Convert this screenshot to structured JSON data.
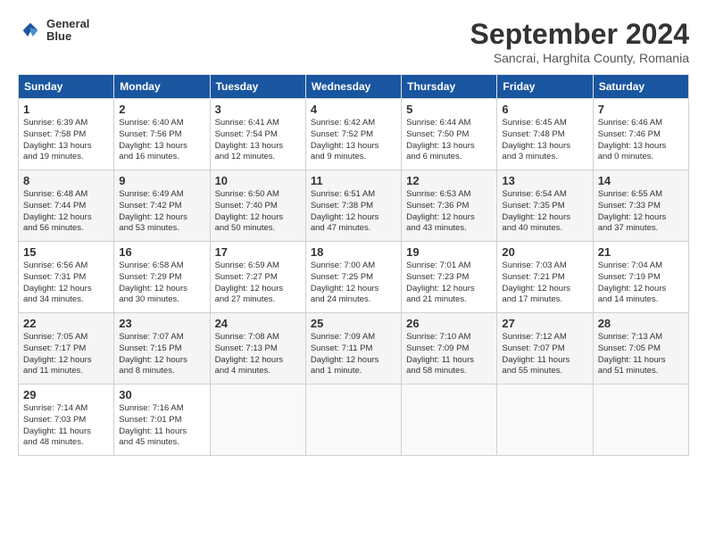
{
  "header": {
    "logo_line1": "General",
    "logo_line2": "Blue",
    "month": "September 2024",
    "location": "Sancrai, Harghita County, Romania"
  },
  "weekdays": [
    "Sunday",
    "Monday",
    "Tuesday",
    "Wednesday",
    "Thursday",
    "Friday",
    "Saturday"
  ],
  "weeks": [
    [
      {
        "day": "1",
        "info": "Sunrise: 6:39 AM\nSunset: 7:58 PM\nDaylight: 13 hours\nand 19 minutes."
      },
      {
        "day": "2",
        "info": "Sunrise: 6:40 AM\nSunset: 7:56 PM\nDaylight: 13 hours\nand 16 minutes."
      },
      {
        "day": "3",
        "info": "Sunrise: 6:41 AM\nSunset: 7:54 PM\nDaylight: 13 hours\nand 12 minutes."
      },
      {
        "day": "4",
        "info": "Sunrise: 6:42 AM\nSunset: 7:52 PM\nDaylight: 13 hours\nand 9 minutes."
      },
      {
        "day": "5",
        "info": "Sunrise: 6:44 AM\nSunset: 7:50 PM\nDaylight: 13 hours\nand 6 minutes."
      },
      {
        "day": "6",
        "info": "Sunrise: 6:45 AM\nSunset: 7:48 PM\nDaylight: 13 hours\nand 3 minutes."
      },
      {
        "day": "7",
        "info": "Sunrise: 6:46 AM\nSunset: 7:46 PM\nDaylight: 13 hours\nand 0 minutes."
      }
    ],
    [
      {
        "day": "8",
        "info": "Sunrise: 6:48 AM\nSunset: 7:44 PM\nDaylight: 12 hours\nand 56 minutes."
      },
      {
        "day": "9",
        "info": "Sunrise: 6:49 AM\nSunset: 7:42 PM\nDaylight: 12 hours\nand 53 minutes."
      },
      {
        "day": "10",
        "info": "Sunrise: 6:50 AM\nSunset: 7:40 PM\nDaylight: 12 hours\nand 50 minutes."
      },
      {
        "day": "11",
        "info": "Sunrise: 6:51 AM\nSunset: 7:38 PM\nDaylight: 12 hours\nand 47 minutes."
      },
      {
        "day": "12",
        "info": "Sunrise: 6:53 AM\nSunset: 7:36 PM\nDaylight: 12 hours\nand 43 minutes."
      },
      {
        "day": "13",
        "info": "Sunrise: 6:54 AM\nSunset: 7:35 PM\nDaylight: 12 hours\nand 40 minutes."
      },
      {
        "day": "14",
        "info": "Sunrise: 6:55 AM\nSunset: 7:33 PM\nDaylight: 12 hours\nand 37 minutes."
      }
    ],
    [
      {
        "day": "15",
        "info": "Sunrise: 6:56 AM\nSunset: 7:31 PM\nDaylight: 12 hours\nand 34 minutes."
      },
      {
        "day": "16",
        "info": "Sunrise: 6:58 AM\nSunset: 7:29 PM\nDaylight: 12 hours\nand 30 minutes."
      },
      {
        "day": "17",
        "info": "Sunrise: 6:59 AM\nSunset: 7:27 PM\nDaylight: 12 hours\nand 27 minutes."
      },
      {
        "day": "18",
        "info": "Sunrise: 7:00 AM\nSunset: 7:25 PM\nDaylight: 12 hours\nand 24 minutes."
      },
      {
        "day": "19",
        "info": "Sunrise: 7:01 AM\nSunset: 7:23 PM\nDaylight: 12 hours\nand 21 minutes."
      },
      {
        "day": "20",
        "info": "Sunrise: 7:03 AM\nSunset: 7:21 PM\nDaylight: 12 hours\nand 17 minutes."
      },
      {
        "day": "21",
        "info": "Sunrise: 7:04 AM\nSunset: 7:19 PM\nDaylight: 12 hours\nand 14 minutes."
      }
    ],
    [
      {
        "day": "22",
        "info": "Sunrise: 7:05 AM\nSunset: 7:17 PM\nDaylight: 12 hours\nand 11 minutes."
      },
      {
        "day": "23",
        "info": "Sunrise: 7:07 AM\nSunset: 7:15 PM\nDaylight: 12 hours\nand 8 minutes."
      },
      {
        "day": "24",
        "info": "Sunrise: 7:08 AM\nSunset: 7:13 PM\nDaylight: 12 hours\nand 4 minutes."
      },
      {
        "day": "25",
        "info": "Sunrise: 7:09 AM\nSunset: 7:11 PM\nDaylight: 12 hours\nand 1 minute."
      },
      {
        "day": "26",
        "info": "Sunrise: 7:10 AM\nSunset: 7:09 PM\nDaylight: 11 hours\nand 58 minutes."
      },
      {
        "day": "27",
        "info": "Sunrise: 7:12 AM\nSunset: 7:07 PM\nDaylight: 11 hours\nand 55 minutes."
      },
      {
        "day": "28",
        "info": "Sunrise: 7:13 AM\nSunset: 7:05 PM\nDaylight: 11 hours\nand 51 minutes."
      }
    ],
    [
      {
        "day": "29",
        "info": "Sunrise: 7:14 AM\nSunset: 7:03 PM\nDaylight: 11 hours\nand 48 minutes."
      },
      {
        "day": "30",
        "info": "Sunrise: 7:16 AM\nSunset: 7:01 PM\nDaylight: 11 hours\nand 45 minutes."
      },
      {
        "day": "",
        "info": ""
      },
      {
        "day": "",
        "info": ""
      },
      {
        "day": "",
        "info": ""
      },
      {
        "day": "",
        "info": ""
      },
      {
        "day": "",
        "info": ""
      }
    ]
  ]
}
